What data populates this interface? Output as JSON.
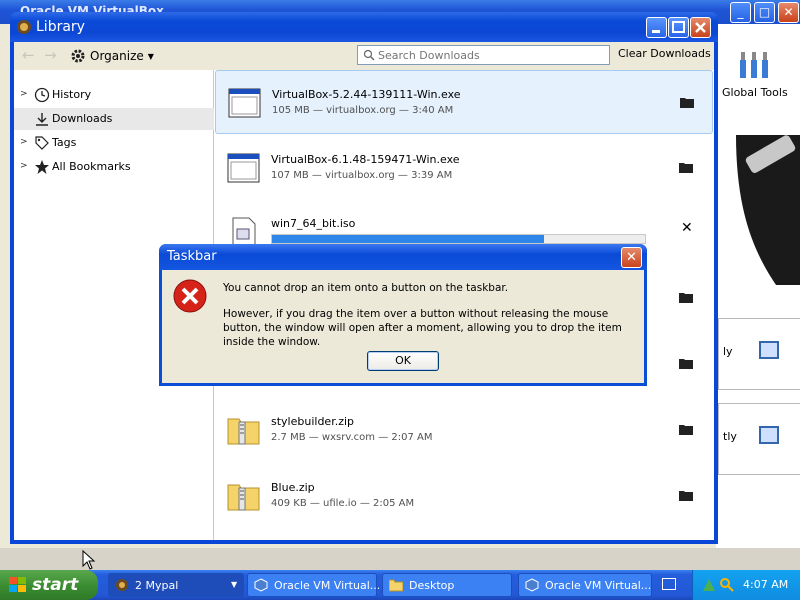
{
  "background_window": {
    "title": "Oracle VM VirtualBox",
    "global_tools_label": "Global Tools",
    "card1_text": "ly",
    "card2_text": "tly"
  },
  "library": {
    "title": "Library",
    "organize_label": "Organize",
    "search_placeholder": "Search Downloads",
    "clear_downloads_label": "Clear Downloads",
    "sidebar": [
      {
        "label": "History",
        "icon": "clock-icon",
        "expandable": true
      },
      {
        "label": "Downloads",
        "icon": "download-icon",
        "expandable": false,
        "selected": true
      },
      {
        "label": "Tags",
        "icon": "tag-icon",
        "expandable": true
      },
      {
        "label": "All Bookmarks",
        "icon": "star-icon",
        "expandable": true
      }
    ],
    "downloads": [
      {
        "name": "VirtualBox-5.2.44-139111-Win.exe",
        "meta": "105 MB — virtualbox.org — 3:40 AM",
        "icon": "exe-icon"
      },
      {
        "name": "VirtualBox-6.1.48-159471-Win.exe",
        "meta": "107 MB — virtualbox.org — 3:39 AM",
        "icon": "exe-icon"
      },
      {
        "name": "win7_64_bit.iso",
        "meta": "",
        "icon": "iso-icon",
        "progress": 0.73
      },
      {
        "name": "stylebuilder.zip",
        "meta": "2.7 MB — wxsrv.com — 2:07 AM",
        "icon": "zip-icon"
      },
      {
        "name": "Blue.zip",
        "meta": "409 KB — ufile.io — 2:05 AM",
        "icon": "zip-icon"
      }
    ]
  },
  "dialog": {
    "title": "Taskbar",
    "message_line1": "You cannot drop an item onto a button on the taskbar.",
    "message_line2": "However, if you drag the item over a button without releasing the mouse button, the window will open after a moment, allowing you to drop the item inside the window.",
    "ok_label": "OK"
  },
  "taskbar": {
    "start_label": "start",
    "buttons": [
      {
        "label": "2 Mypal",
        "icon": "mypal-icon"
      },
      {
        "label": "Oracle VM Virtual...",
        "icon": "virtualbox-icon"
      },
      {
        "label": "Desktop",
        "icon": "folder-icon"
      },
      {
        "label": "Oracle VM Virtual...",
        "icon": "virtualbox-icon"
      }
    ],
    "clock": "4:07 AM"
  }
}
